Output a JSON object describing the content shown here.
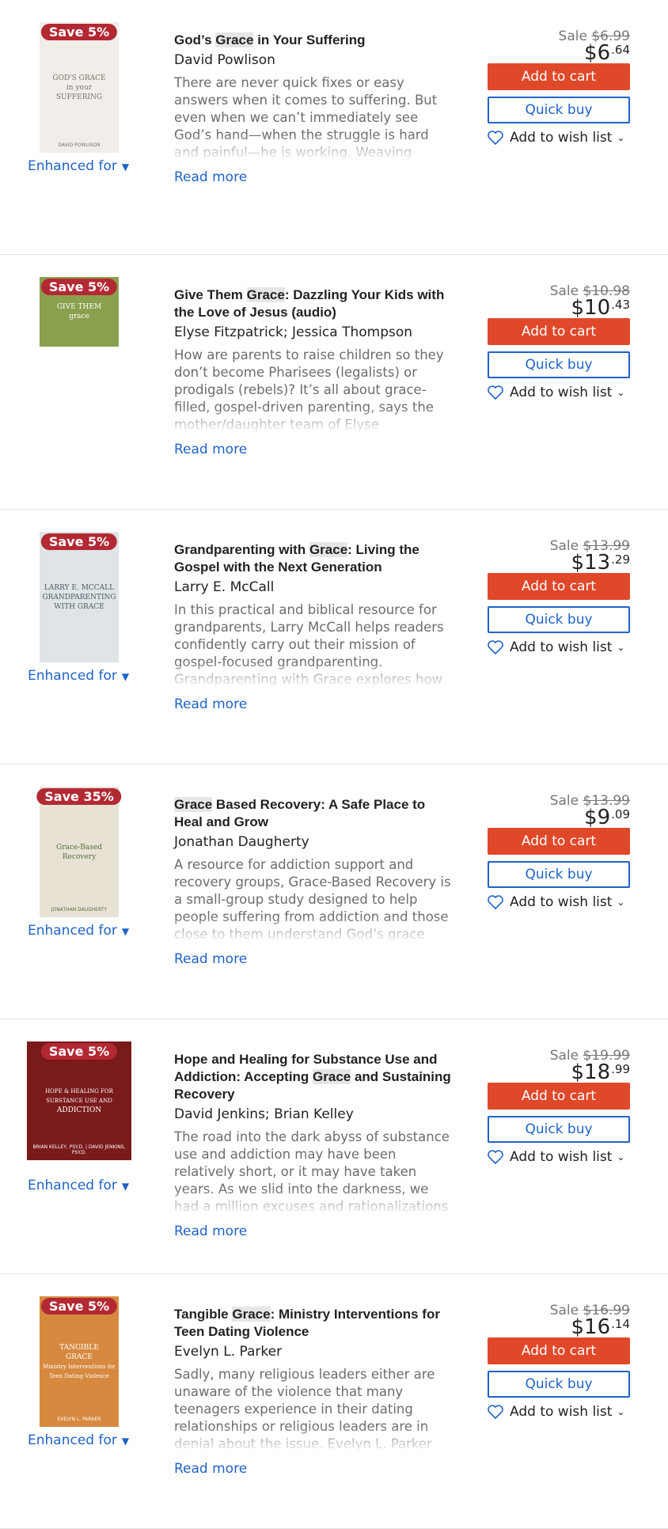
{
  "labels": {
    "add_to_cart": "Add to cart",
    "quick_buy": "Quick buy",
    "add_to_wish_list": "Add to wish list",
    "read_more": "Read more",
    "enhanced_for": "Enhanced for",
    "sale": "Sale"
  },
  "colors": {
    "accent_link": "#1f63c6",
    "cart_button": "#e0482a",
    "badge": "#b32933"
  },
  "products": [
    {
      "badge": "Save 5%",
      "title_before": "God’s ",
      "title_hl": "Grace",
      "title_after": " in Your Suffering",
      "author": "David Powlison",
      "description": "There are never quick fixes or easy answers when it comes to suffering. But even when we can’t immediately see God’s hand—when the struggle is hard and painful—he is working. Weaving together",
      "original_price": "$6.99",
      "price_dollars": "$6",
      "price_cents": ".64",
      "enhanced": true,
      "cover": {
        "lines": [
          "GOD'S GRACE",
          "in your",
          "SUFFERING"
        ],
        "footer": "DAVID POWLISON",
        "bg": "#f1eeea",
        "fg": "#7b6f66"
      }
    },
    {
      "badge": "Save 5%",
      "title_before": "Give Them ",
      "title_hl": "Grace",
      "title_after": ": Dazzling Your Kids with the Love of Jesus (audio)",
      "author": "Elyse Fitzpatrick; Jessica Thompson",
      "description": "How are parents to raise children so they don’t become Pharisees (legalists) or prodigals (rebels)? It’s all about grace-filled, gospel-driven parenting, says the mother/daughter team of Elyse",
      "original_price": "$10.98",
      "price_dollars": "$10",
      "price_cents": ".43",
      "enhanced": false,
      "cover": {
        "lines": [
          "GIVE THEM",
          "grace"
        ],
        "footer": "",
        "bg": "#8aa04d",
        "fg": "#ffffff"
      }
    },
    {
      "badge": "Save 5%",
      "title_before": "Grandparenting with ",
      "title_hl": "Grace",
      "title_after": ": Living the Gospel with the Next Generation",
      "author": "Larry E. McCall",
      "description": "In this practical and biblical resource for grandparents, Larry McCall helps readers confidently carry out their mission of gospel-focused grandparenting. Grandparenting with Grace explores how",
      "original_price": "$13.99",
      "price_dollars": "$13",
      "price_cents": ".29",
      "enhanced": true,
      "cover": {
        "lines": [
          "LARRY E. MCCALL",
          "GRANDPARENTING",
          "WITH GRACE"
        ],
        "footer": "",
        "bg": "#dfe4e6",
        "fg": "#4b5a66"
      }
    },
    {
      "badge": "Save 35%",
      "title_before": "",
      "title_hl": "Grace",
      "title_after": " Based Recovery: A Safe Place to Heal and Grow",
      "author": "Jonathan Daugherty",
      "description": "A resource for addiction support and recovery groups, Grace-Based Recovery is a small-group study designed to help people suffering from addiction and those close to them understand God’s grace and",
      "original_price": "$13.99",
      "price_dollars": "$9",
      "price_cents": ".09",
      "enhanced": true,
      "cover": {
        "lines": [
          "Grace-Based",
          "Recovery"
        ],
        "footer": "JONATHAN DAUGHERTY",
        "bg": "#e7e2d4",
        "fg": "#5a6e3a"
      }
    },
    {
      "badge": "Save 5%",
      "title_before": "Hope and Healing for Substance Use and Addiction: Accepting ",
      "title_hl": "Grace",
      "title_after": " and Sustaining Recovery",
      "author": "David Jenkins; Brian Kelley",
      "description": "The road into the dark abyss of substance use and addiction may have been relatively short, or it may have taken years. As we slid into the darkness, we had a million excuses and rationalizations",
      "original_price": "$19.99",
      "price_dollars": "$18",
      "price_cents": ".99",
      "enhanced": true,
      "cover": {
        "lines": [
          "HOPE & HEALING FOR",
          "SUBSTANCE USE AND",
          "ADDICTION"
        ],
        "footer": "BRIAN KELLEY, PSY.D. | DAVID JENKINS, PSY.D.",
        "bg": "#7a1a1a",
        "fg": "#ffffff"
      }
    },
    {
      "badge": "Save 5%",
      "title_before": "Tangible ",
      "title_hl": "Grace",
      "title_after": ": Ministry Interventions for Teen Dating Violence",
      "author": "Evelyn L. Parker",
      "description": "Sadly, many religious leaders either are unaware of the violence that many teenagers experience in their dating relationships or religious leaders are in denial about the issue. Evelyn L. Parker",
      "original_price": "$16.99",
      "price_dollars": "$16",
      "price_cents": ".14",
      "enhanced": true,
      "cover": {
        "lines": [
          "TANGIBLE",
          "GRACE",
          "Ministry Interventions for",
          "Teen Dating Violence"
        ],
        "footer": "EVELYN L. PARKER",
        "bg": "#d7893f",
        "fg": "#ffffff"
      }
    }
  ]
}
